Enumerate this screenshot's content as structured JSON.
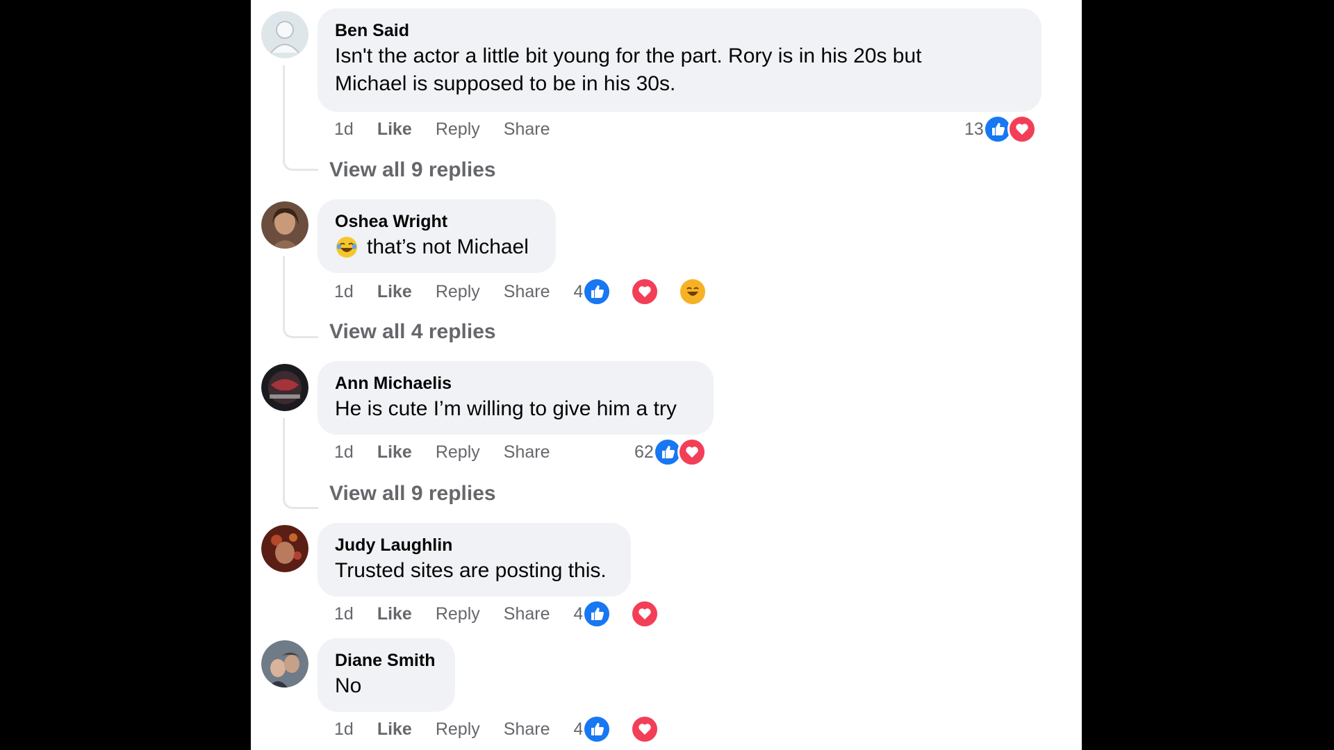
{
  "comments": [
    {
      "author": "Ben Said",
      "text_lines": [
        "Isn't the actor a little bit young for the part. Rory is in his 20s but",
        "Michael is supposed to be in his 30s."
      ],
      "time": "1d",
      "like_label": "Like",
      "reply_label": "Reply",
      "share_label": "Share",
      "reaction_count": "13",
      "reactions": [
        "like",
        "love"
      ],
      "view_replies": "View all 9 replies"
    },
    {
      "author": "Oshea Wright",
      "emoji": "laughing-tears",
      "text_lines": [
        "that’s not Michael"
      ],
      "time": "1d",
      "like_label": "Like",
      "reply_label": "Reply",
      "share_label": "Share",
      "reaction_count": "4",
      "reactions": [
        "like",
        "love",
        "haha"
      ],
      "view_replies": "View all 4 replies"
    },
    {
      "author": "Ann Michaelis",
      "text_lines": [
        "He is cute I’m willing to give him a try"
      ],
      "time": "1d",
      "like_label": "Like",
      "reply_label": "Reply",
      "share_label": "Share",
      "reaction_count": "62",
      "reactions": [
        "like",
        "love"
      ],
      "view_replies": "View all 9 replies"
    },
    {
      "author": "Judy Laughlin",
      "text_lines": [
        "Trusted sites are posting this."
      ],
      "time": "1d",
      "like_label": "Like",
      "reply_label": "Reply",
      "share_label": "Share",
      "reaction_count": "4",
      "reactions": [
        "like",
        "love"
      ]
    },
    {
      "author": "Diane Smith",
      "text_lines": [
        "No"
      ],
      "time": "1d",
      "like_label": "Like",
      "reply_label": "Reply",
      "share_label": "Share",
      "reaction_count": "4",
      "reactions": [
        "like",
        "love"
      ]
    }
  ],
  "colors": {
    "page_bg": "#000000",
    "panel_bg": "#ffffff",
    "bubble_bg": "#f0f2f5",
    "text_primary": "#050505",
    "text_secondary": "#65676b",
    "like_blue": "#1877f2",
    "love_red": "#f33e58"
  }
}
